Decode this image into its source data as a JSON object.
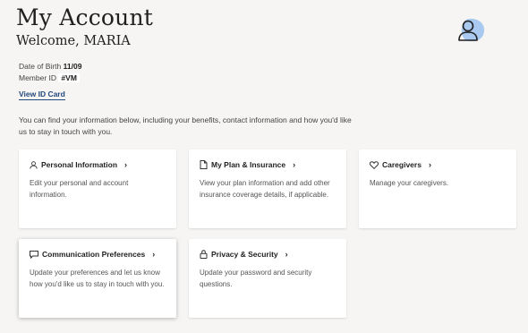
{
  "header": {
    "title": "My Account",
    "welcome": "Welcome, MARIA"
  },
  "member": {
    "dob_label": "Date of Birth",
    "dob_value": "11/09",
    "id_label": "Member ID",
    "id_value": "#VM",
    "view_id_card": "View ID Card"
  },
  "intro": "You can find your information below, including your benefits, contact information and how you'd like us to stay in touch with you.",
  "cards": [
    {
      "title": "Personal Information",
      "description": "Edit your personal and account information.",
      "icon": "person-icon"
    },
    {
      "title": "My Plan & Insurance",
      "description": "View your plan information and add other insurance coverage details, if applicable.",
      "icon": "document-icon"
    },
    {
      "title": "Caregivers",
      "description": "Manage your caregivers.",
      "icon": "heart-icon"
    },
    {
      "title": "Communication Preferences",
      "description": "Update your preferences and let us know how you'd like us to stay in touch with you.",
      "icon": "chat-bubble-icon"
    },
    {
      "title": "Privacy & Security",
      "description": "Update your password and security questions.",
      "icon": "lock-icon"
    }
  ],
  "colors": {
    "background": "#f6f5f3",
    "link": "#20497e",
    "avatar_accent": "#a9c9f0"
  }
}
